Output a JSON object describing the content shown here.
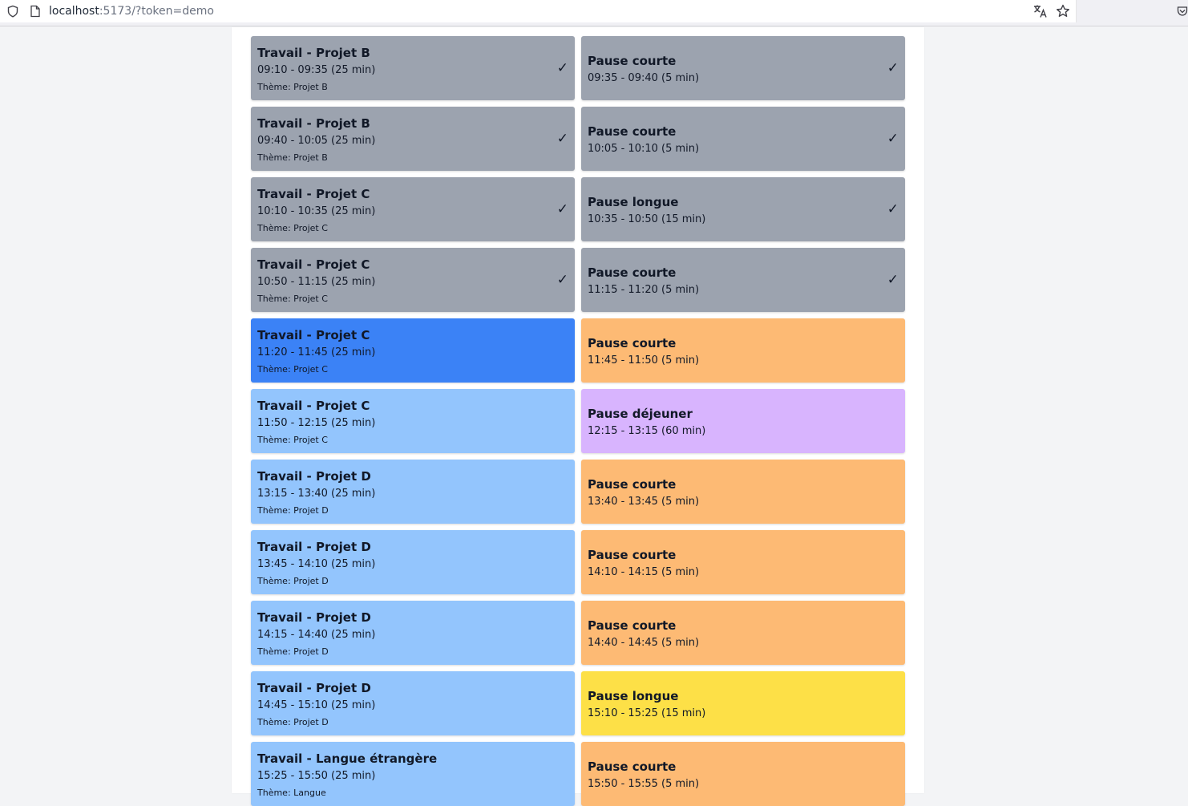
{
  "browser": {
    "url_host": "localhost",
    "url_rest": ":5173/?token=demo"
  },
  "colors": {
    "done": "#9ca3af",
    "current": "#3b82f6",
    "work_todo": "#93c5fd",
    "short_break": "#fdba74",
    "lunch_break": "#d8b4fe",
    "long_break": "#fde047"
  },
  "checkmark": "✓",
  "rows": [
    {
      "work": {
        "title": "Travail - Projet B",
        "time": "09:10 - 09:35 (25 min)",
        "theme": "Thème: Projet B",
        "status": "done"
      },
      "pause": {
        "title": "Pause courte",
        "time": "09:35 - 09:40 (5 min)",
        "status": "done"
      }
    },
    {
      "work": {
        "title": "Travail - Projet B",
        "time": "09:40 - 10:05 (25 min)",
        "theme": "Thème: Projet B",
        "status": "done"
      },
      "pause": {
        "title": "Pause courte",
        "time": "10:05 - 10:10 (5 min)",
        "status": "done"
      }
    },
    {
      "work": {
        "title": "Travail - Projet C",
        "time": "10:10 - 10:35 (25 min)",
        "theme": "Thème: Projet C",
        "status": "done"
      },
      "pause": {
        "title": "Pause longue",
        "time": "10:35 - 10:50 (15 min)",
        "status": "done"
      }
    },
    {
      "work": {
        "title": "Travail - Projet C",
        "time": "10:50 - 11:15 (25 min)",
        "theme": "Thème: Projet C",
        "status": "done"
      },
      "pause": {
        "title": "Pause courte",
        "time": "11:15 - 11:20 (5 min)",
        "status": "done"
      }
    },
    {
      "work": {
        "title": "Travail - Projet C",
        "time": "11:20 - 11:45 (25 min)",
        "theme": "Thème: Projet C",
        "status": "current"
      },
      "pause": {
        "title": "Pause courte",
        "time": "11:45 - 11:50 (5 min)",
        "status": "short-break"
      }
    },
    {
      "work": {
        "title": "Travail - Projet C",
        "time": "11:50 - 12:15 (25 min)",
        "theme": "Thème: Projet C",
        "status": "work-todo"
      },
      "pause": {
        "title": "Pause déjeuner",
        "time": "12:15 - 13:15 (60 min)",
        "status": "lunch-break"
      }
    },
    {
      "work": {
        "title": "Travail - Projet D",
        "time": "13:15 - 13:40 (25 min)",
        "theme": "Thème: Projet D",
        "status": "work-todo"
      },
      "pause": {
        "title": "Pause courte",
        "time": "13:40 - 13:45 (5 min)",
        "status": "short-break"
      }
    },
    {
      "work": {
        "title": "Travail - Projet D",
        "time": "13:45 - 14:10 (25 min)",
        "theme": "Thème: Projet D",
        "status": "work-todo"
      },
      "pause": {
        "title": "Pause courte",
        "time": "14:10 - 14:15 (5 min)",
        "status": "short-break"
      }
    },
    {
      "work": {
        "title": "Travail - Projet D",
        "time": "14:15 - 14:40 (25 min)",
        "theme": "Thème: Projet D",
        "status": "work-todo"
      },
      "pause": {
        "title": "Pause courte",
        "time": "14:40 - 14:45 (5 min)",
        "status": "short-break"
      }
    },
    {
      "work": {
        "title": "Travail - Projet D",
        "time": "14:45 - 15:10 (25 min)",
        "theme": "Thème: Projet D",
        "status": "work-todo"
      },
      "pause": {
        "title": "Pause longue",
        "time": "15:10 - 15:25 (15 min)",
        "status": "long-break"
      }
    },
    {
      "work": {
        "title": "Travail - Langue étrangère",
        "time": "15:25 - 15:50 (25 min)",
        "theme": "Thème: Langue",
        "status": "work-todo"
      },
      "pause": {
        "title": "Pause courte",
        "time": "15:50 - 15:55 (5 min)",
        "status": "short-break"
      }
    }
  ]
}
